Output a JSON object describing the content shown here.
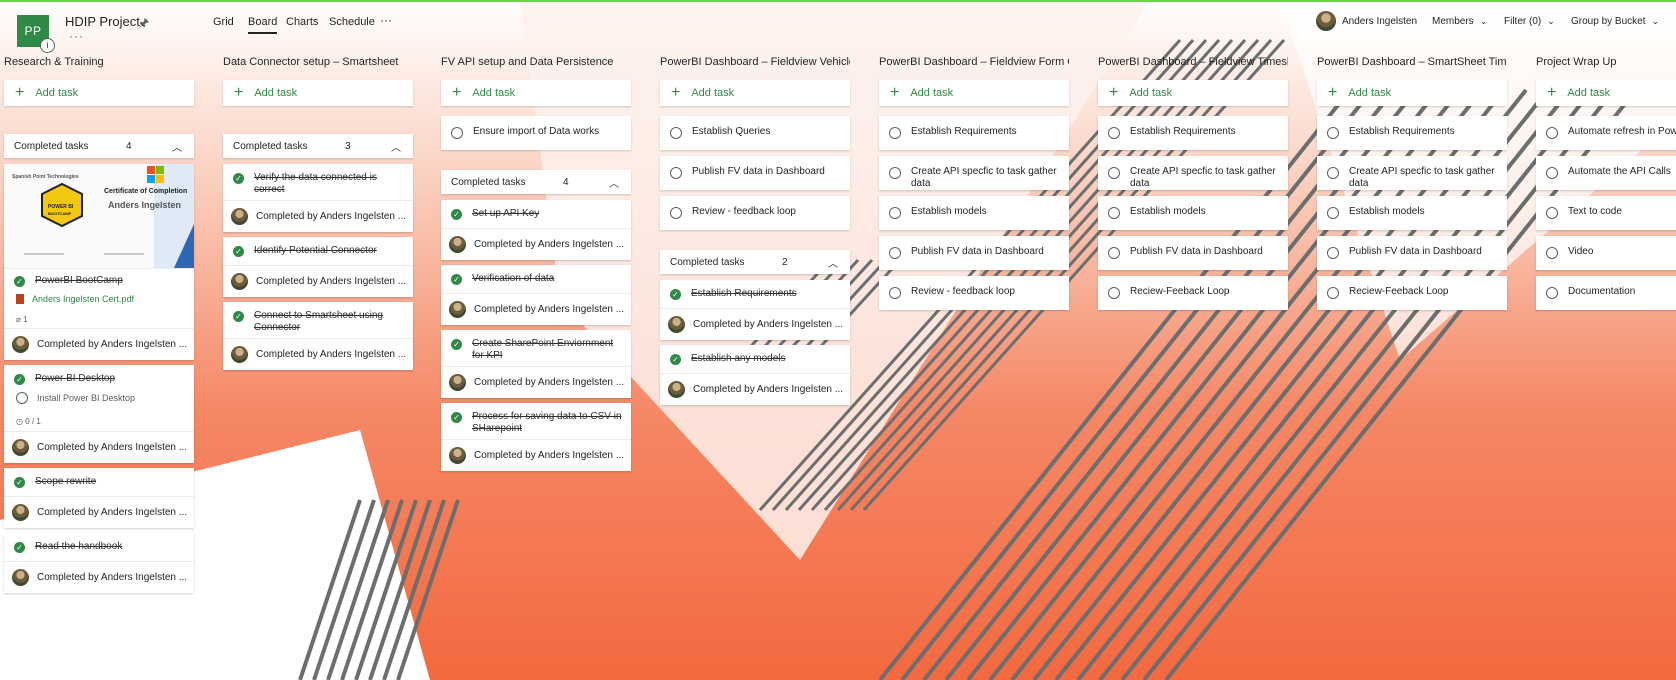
{
  "project": {
    "logo": "PP",
    "title": "HDIP Project",
    "info": "i",
    "more": "···"
  },
  "nav": {
    "tabs": [
      "Grid",
      "Board",
      "Charts",
      "Schedule"
    ],
    "more": "···"
  },
  "toolbar": {
    "user": "Anders Ingelsten",
    "members": "Members",
    "filter": "Filter (0)",
    "group": "Group by Bucket"
  },
  "labels": {
    "add_task": "Add task",
    "completed_tasks": "Completed tasks",
    "completed_by": "Completed by Anders Ingelsten ..."
  },
  "cert": {
    "org": "Spanish Point Technologies",
    "heading": "Certificate of Completion",
    "name": "Anders Ingelsten",
    "badge_top": "POWER BI",
    "badge_bottom": "BOOTCAMP"
  },
  "icons": {
    "pin": "pin-icon",
    "check": "check-icon",
    "circle": "circle-icon",
    "plus": "plus-icon",
    "chevron": "chevron-down-icon",
    "collapse": "chevron-up-icon",
    "attachment": "paperclip-icon",
    "checklist": "checklist-icon",
    "pdf": "pdf-file-icon"
  },
  "colors": {
    "brand": "#2f8a46",
    "accent_top": "#6bd34e",
    "background": "#f4693f"
  },
  "columns": [
    {
      "title": "Research & Training",
      "completed": {
        "count": "4",
        "tasks": [
          {
            "title": "PowerBI BootCamp",
            "attachment": "Anders Ingelsten Cert.pdf",
            "attach_count": "1"
          },
          {
            "title": "Power BI Desktop",
            "subtask": "Install Power BI Desktop",
            "checklist": "0 / 1"
          },
          {
            "title": "Scope rewrite"
          },
          {
            "title": "Read the handbook"
          }
        ]
      }
    },
    {
      "title": "Data Connector setup – Smartsheet",
      "completed": {
        "count": "3",
        "tasks": [
          {
            "title": "Verify the data connected is correct"
          },
          {
            "title": "Identify Potential Connector"
          },
          {
            "title": "Connect to Smartsheet using Connector"
          }
        ]
      }
    },
    {
      "title": "FV API setup and Data Persistence",
      "open": [
        "Ensure import of Data works"
      ],
      "completed": {
        "count": "4",
        "tasks": [
          {
            "title": "Set up API Key"
          },
          {
            "title": "Verification of data"
          },
          {
            "title": "Create SharePoint Enviornment for KPI"
          },
          {
            "title": "Process for saving data to CSV in SHarepoint"
          }
        ]
      }
    },
    {
      "title": "PowerBI Dashboard – Fieldview Vehicle-",
      "open": [
        "Establish Queries",
        "Publish FV data in Dashboard",
        "Review - feedback loop"
      ],
      "completed": {
        "count": "2",
        "tasks": [
          {
            "title": "Establish Requirements"
          },
          {
            "title": "Establish any models"
          }
        ]
      }
    },
    {
      "title": "PowerBI Dashboard – Fieldview Form Co",
      "open": [
        "Establish Requirements",
        "Create API specfic to task gather data",
        "Establish models",
        "Publish FV data in Dashboard",
        "Review - feedback loop"
      ]
    },
    {
      "title": "PowerBI Dashboard – Fieldview Timeshe",
      "open": [
        "Establish Requirements",
        "Create API specfic to task gather data",
        "Establish models",
        "Publish FV data in Dashboard",
        "Reciew-Feeback Loop"
      ]
    },
    {
      "title": "PowerBI Dashboard – SmartSheet Times",
      "open": [
        "Establish Requirements",
        "Create API specfic to task gather data",
        "Establish models",
        "Publish FV data in Dashboard",
        "Reciew-Feeback Loop"
      ]
    },
    {
      "title": "Project Wrap Up",
      "open": [
        "Automate refresh in PowerBI",
        "Automate the API Calls",
        "Text to code",
        "Video",
        "Documentation"
      ]
    }
  ]
}
